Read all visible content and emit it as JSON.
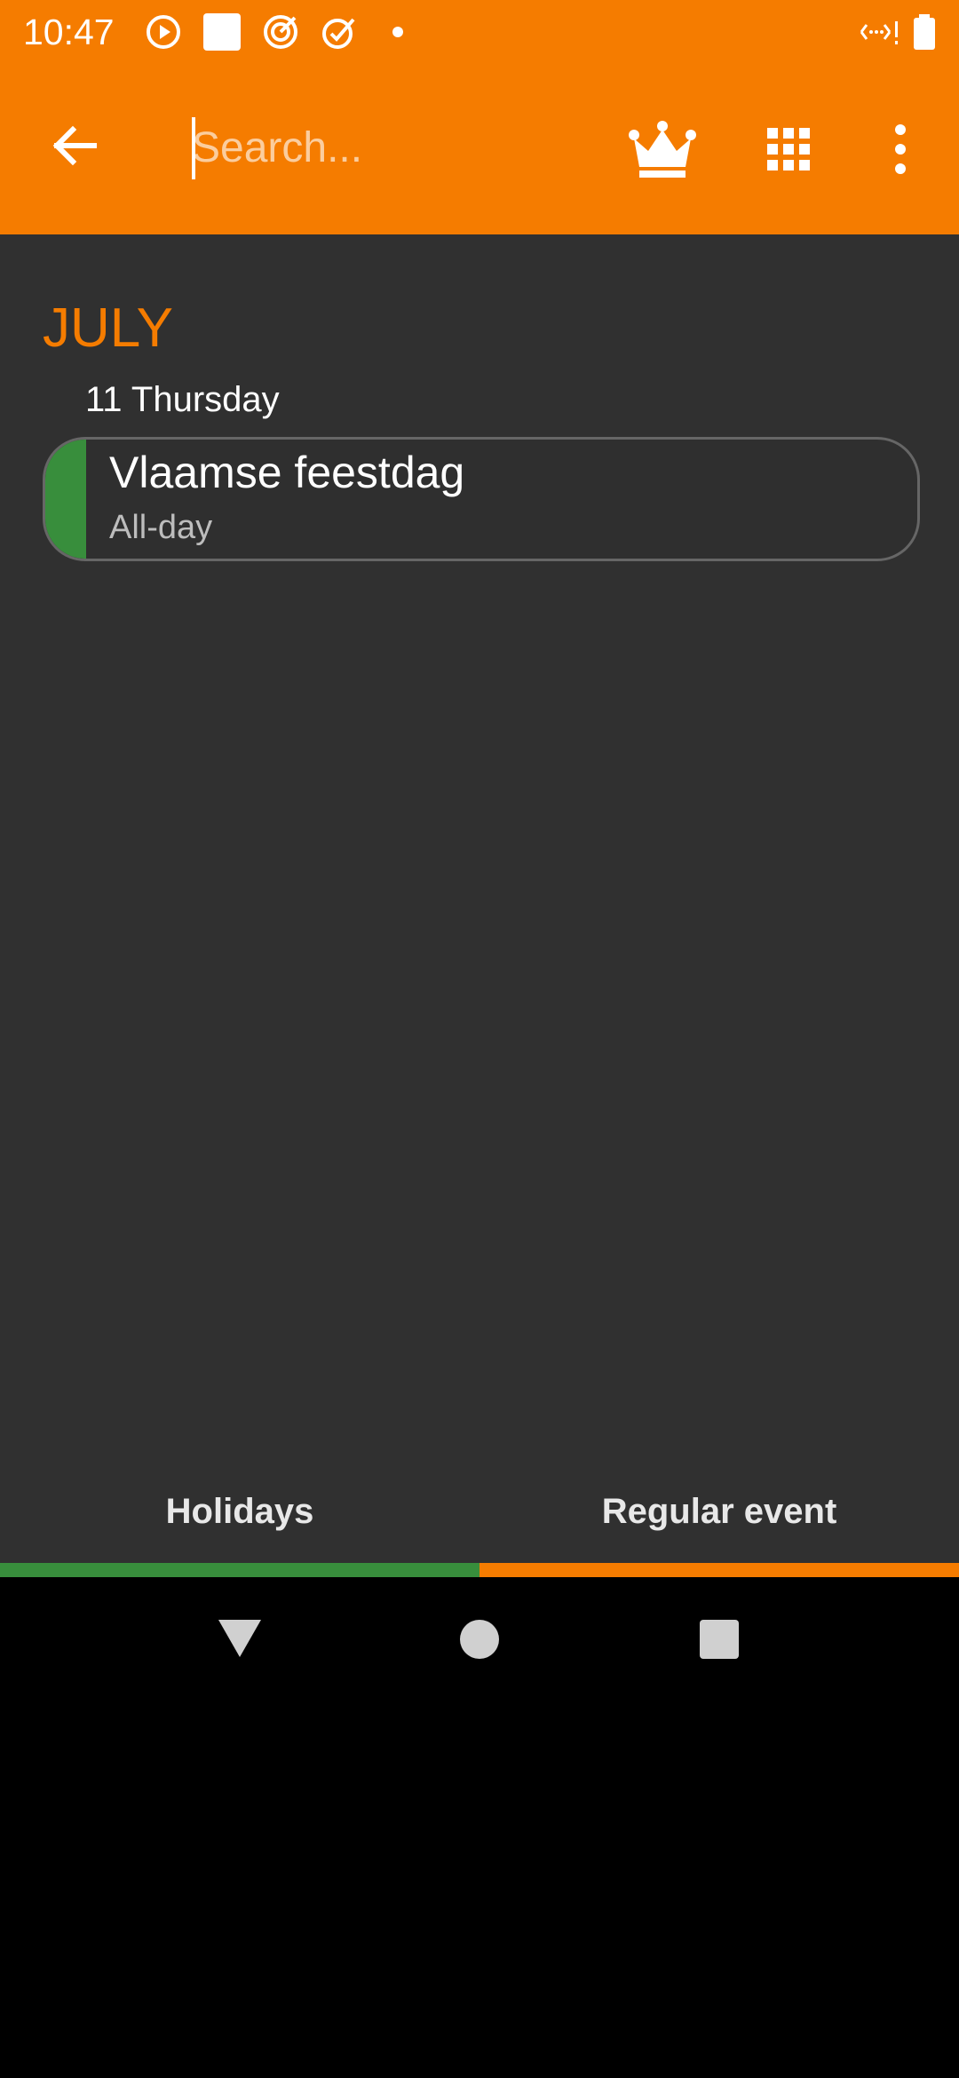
{
  "status_bar": {
    "time": "10:47",
    "icons": [
      "play-circle-icon",
      "square-icon",
      "target-icon",
      "check-icon",
      "dot-icon",
      "signal-icon",
      "battery-icon"
    ]
  },
  "app_bar": {
    "search_placeholder": "Search...",
    "search_value": "",
    "icons": [
      "back-arrow-icon",
      "crown-icon",
      "grid-icon",
      "more-vert-icon"
    ]
  },
  "agenda": {
    "month": "JULY",
    "day": "11 Thursday",
    "events": [
      {
        "title": "Vlaamse feestdag",
        "time": "All-day",
        "color": "#388e3c"
      }
    ]
  },
  "legend": {
    "items": [
      {
        "label": "Holidays",
        "color": "#388e3c"
      },
      {
        "label": "Regular event",
        "color": "#f57c00"
      }
    ]
  },
  "nav_bar": {
    "icons": [
      "back-triangle-icon",
      "home-circle-icon",
      "recents-square-icon"
    ]
  },
  "colors": {
    "accent": "#f57c00",
    "background": "#303030",
    "holiday": "#388e3c"
  }
}
